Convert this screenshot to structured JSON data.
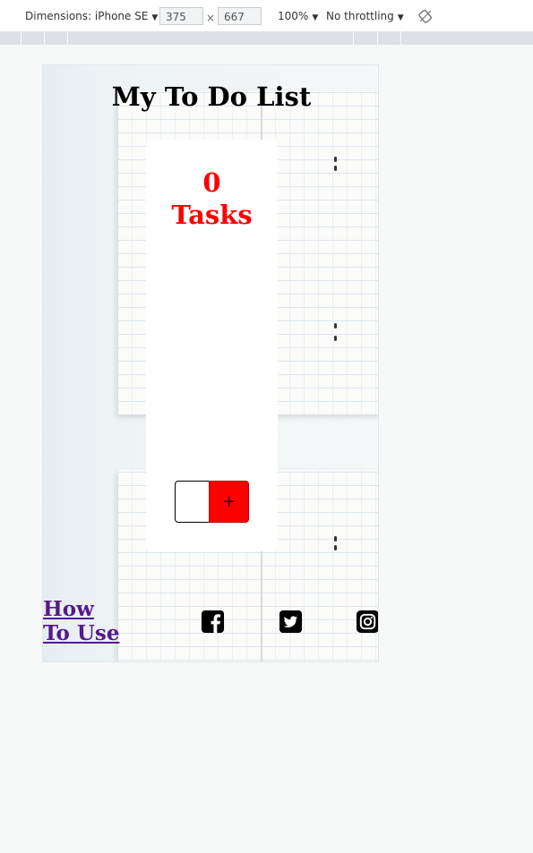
{
  "devtools": {
    "dimensions_label": "Dimensions: iPhone SE",
    "width_value": "375",
    "height_value": "667",
    "times": "×",
    "zoom": "100%",
    "throttling": "No throttling"
  },
  "app": {
    "title": "My To Do List",
    "task_count_number": "0",
    "task_count_word": "Tasks",
    "add_label": "+",
    "how_to_use": "How To Use"
  },
  "icons": {
    "facebook": "facebook-icon",
    "twitter": "twitter-icon",
    "instagram": "instagram-icon",
    "rotate": "rotate-icon"
  },
  "colors": {
    "accent": "#ff0000",
    "link": "#551a8b"
  }
}
